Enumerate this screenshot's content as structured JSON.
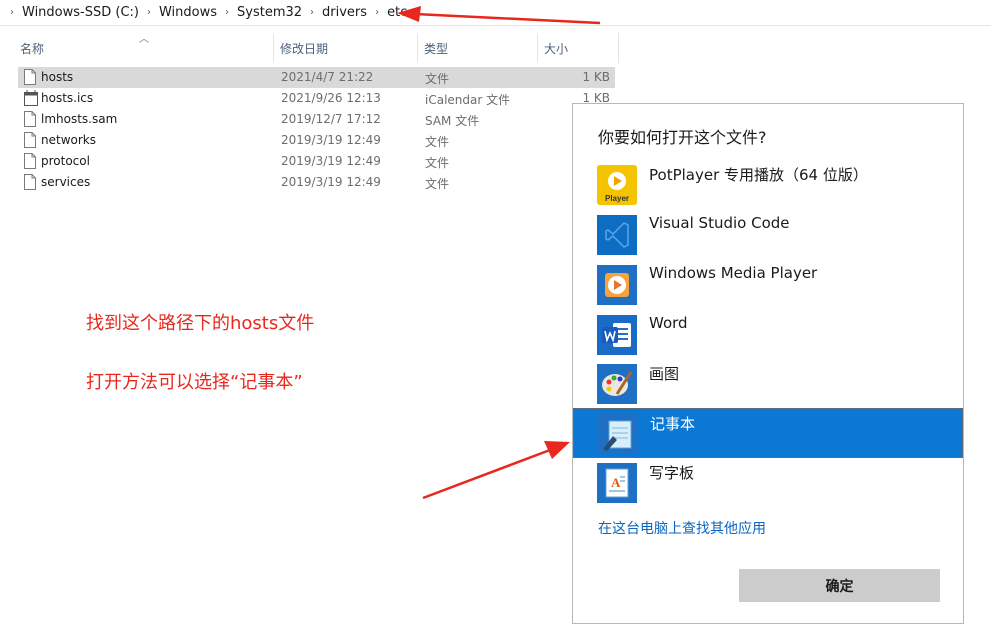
{
  "breadcrumb": {
    "items": [
      "Windows-SSD (C:)",
      "Windows",
      "System32",
      "drivers",
      "etc"
    ]
  },
  "columns": {
    "name": "名称",
    "date": "修改日期",
    "type": "类型",
    "size": "大小"
  },
  "files": [
    {
      "name": "hosts",
      "date": "2021/4/7 21:22",
      "type": "文件",
      "size": "1 KB",
      "selected": true
    },
    {
      "name": "hosts.ics",
      "date": "2021/9/26 12:13",
      "type": "iCalendar 文件",
      "size": "1 KB"
    },
    {
      "name": "lmhosts.sam",
      "date": "2019/12/7 17:12",
      "type": "SAM 文件",
      "size": ""
    },
    {
      "name": "networks",
      "date": "2019/3/19 12:49",
      "type": "文件",
      "size": ""
    },
    {
      "name": "protocol",
      "date": "2019/3/19 12:49",
      "type": "文件",
      "size": ""
    },
    {
      "name": "services",
      "date": "2019/3/19 12:49",
      "type": "文件",
      "size": ""
    }
  ],
  "annotations": {
    "line1": "找到这个路径下的hosts文件",
    "line2": "打开方法可以选择“记事本”",
    "color": "#e8281e"
  },
  "dialog": {
    "title": "你要如何打开这个文件?",
    "apps": [
      {
        "label": "PotPlayer 专用播放（64 位版）",
        "icon": "potplayer-icon"
      },
      {
        "label": "Visual Studio Code",
        "icon": "vscode-icon"
      },
      {
        "label": "Windows Media Player",
        "icon": "media-player-icon"
      },
      {
        "label": "Word",
        "icon": "word-icon"
      },
      {
        "label": "画图",
        "icon": "paint-icon"
      },
      {
        "label": "记事本",
        "icon": "notepad-icon",
        "selected": true
      },
      {
        "label": "写字板",
        "icon": "wordpad-icon"
      }
    ],
    "more_link": "在这台电脑上查找其他应用",
    "ok_label": "确定",
    "potplayer_icon_text": "Player",
    "accent": "#0b78d4"
  }
}
